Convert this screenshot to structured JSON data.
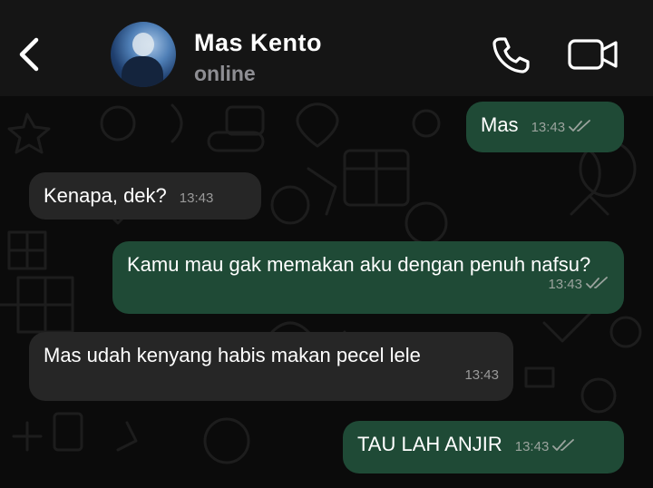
{
  "header": {
    "contact_name": "Mas Kento",
    "status": "online",
    "back_icon": "chevron-left-icon",
    "call_icon": "phone-icon",
    "video_icon": "video-camera-icon"
  },
  "colors": {
    "header_bg": "#151515",
    "chat_bg": "#0b0b0b",
    "outgoing_bubble": "#1f4a36",
    "incoming_bubble": "#262626",
    "text": "#ffffff",
    "status_text": "#8e8e93"
  },
  "messages": [
    {
      "direction": "outgoing",
      "text": "Mas",
      "time": "13:43",
      "read": true
    },
    {
      "direction": "incoming",
      "text": "Kenapa, dek?",
      "time": "13:43"
    },
    {
      "direction": "outgoing",
      "text": "Kamu mau gak memakan aku dengan penuh nafsu?",
      "time": "13:43",
      "read": true
    },
    {
      "direction": "incoming",
      "text": "Mas udah kenyang habis makan pecel lele",
      "time": "13:43"
    },
    {
      "direction": "outgoing",
      "text": "TAU LAH ANJIR",
      "time": "13:43",
      "read": true
    }
  ]
}
